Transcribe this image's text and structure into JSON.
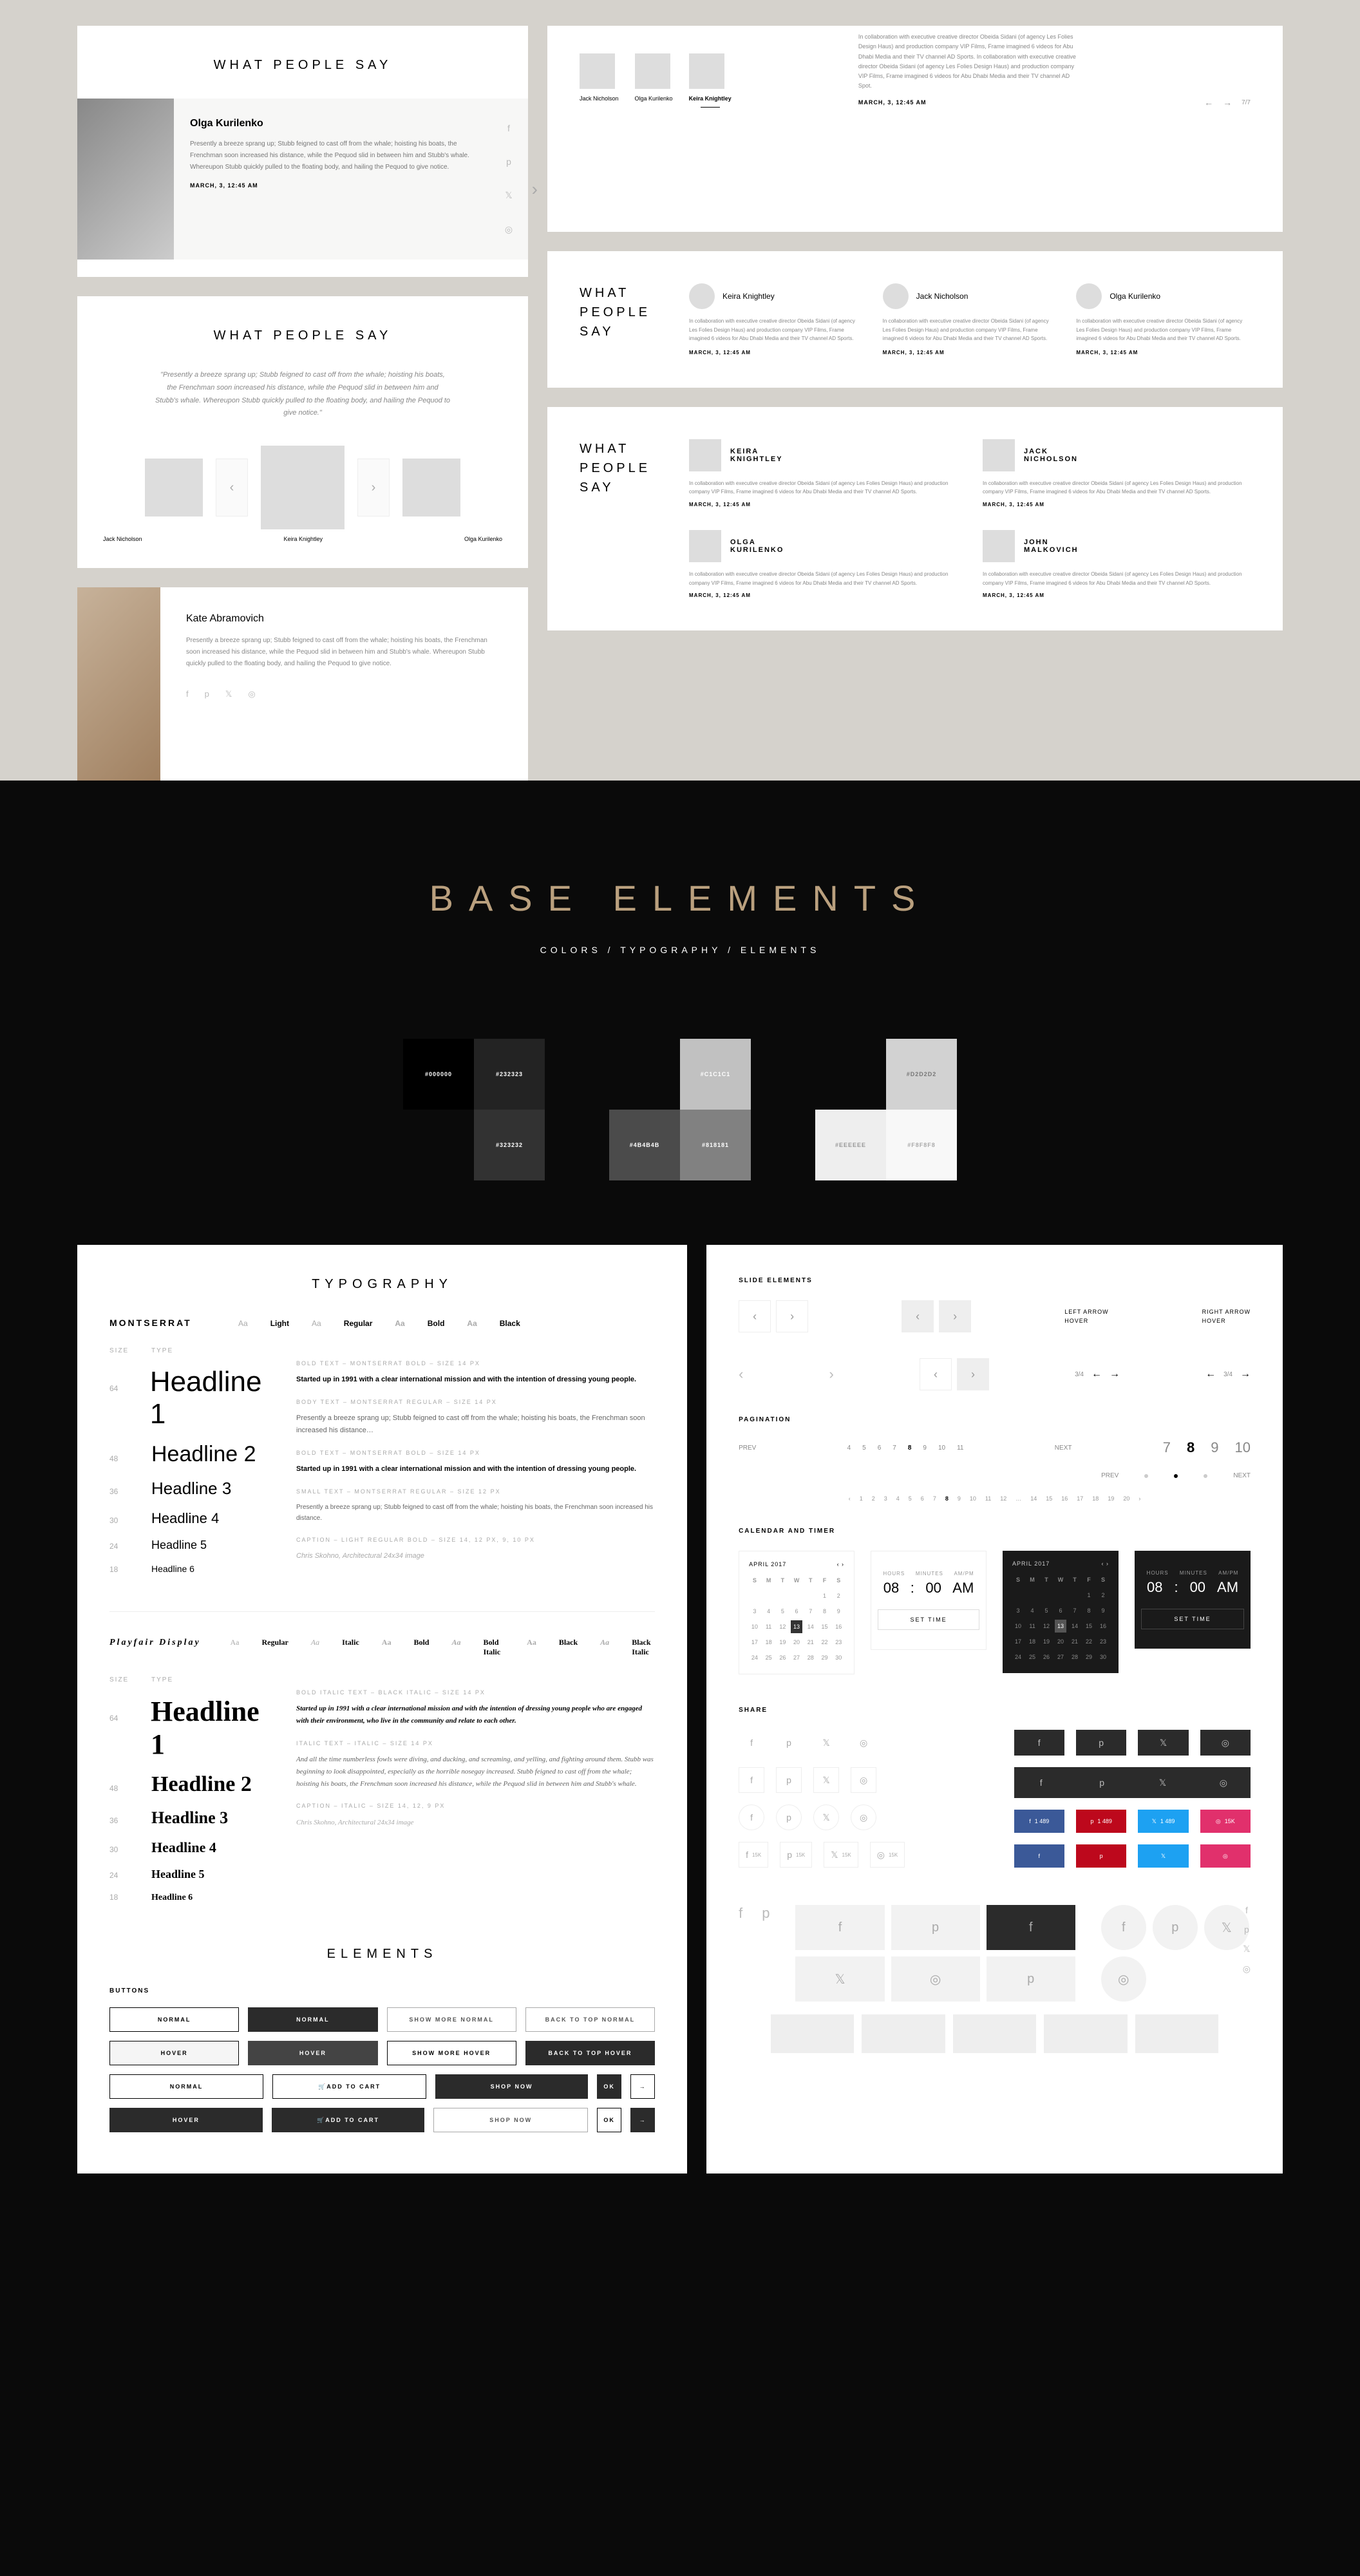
{
  "top": {
    "wps_title": "WHAT PEOPLE SAY",
    "quote": "\"Presently a breeze sprang up; Stubb feigned to cast off from the whale; hoisting his boats, the Frenchman soon increased his distance, while the Pequod slid in between him and Stubb's whale. Whereupon Stubb quickly pulled to the floating body, and hailing the Pequod to give notice.\"",
    "lorem_short": "Presently a breeze sprang up; Stubb feigned to cast off from the whale; hoisting his boats, the Frenchman soon increased his distance, while the Pequod slid in between him and Stubb's whale. Whereupon Stubb quickly pulled to the floating body, and hailing the Pequod to give notice.",
    "lorem_med": "In collaboration with executive creative director Obeida Sidani (of agency Les Folies Design Haus) and production company VIP Films, Frame imagined 6 videos for Abu Dhabi Media and their TV channel AD Sports. In collaboration with executive creative director Obeida Sidani (of agency Les Folies Design Haus) and production company VIP Films, Frame imagined 6 videos for Abu Dhabi Media and their TV channel AD Spot.",
    "lorem_tiny": "In collaboration with executive creative director Obeida Sidani (of agency Les Folies Design Haus) and production company VIP Films, Frame imagined 6 videos for Abu Dhabi Media and their TV channel AD Sports.",
    "date": "MARCH, 3, 12:45 AM",
    "people": {
      "ok": "Olga Kurilenko",
      "kk": "Keira Knightley",
      "jn": "Jack Nicholson",
      "ka": "Kate Abramovich",
      "jm": "John Malkovich"
    },
    "nav_count": "7/7"
  },
  "base": {
    "title": "BASE ELEMENTS",
    "sub": "COLORS / TYPOGRAPHY / ELEMENTS",
    "swatches": [
      "#000000",
      "#232323",
      "#323232",
      "#C1C1C1",
      "#4B4B4B",
      "#818181",
      "#D2D2D2",
      "#EEEEEE",
      "#F8F8F8"
    ]
  },
  "typo": {
    "title": "TYPOGRAPHY",
    "font1": "MONTSERRAT",
    "font2": "Playfair Display",
    "weights": [
      "Light",
      "Regular",
      "Bold",
      "Black"
    ],
    "weights2": [
      "Regular",
      "Italic",
      "Bold",
      "Bold Italic",
      "Black",
      "Black Italic"
    ],
    "size_label": "SIZE",
    "type_label": "TYPE",
    "heads": [
      {
        "sz": "64",
        "name": "Headline 1"
      },
      {
        "sz": "48",
        "name": "Headline 2"
      },
      {
        "sz": "36",
        "name": "Headline 3"
      },
      {
        "sz": "30",
        "name": "Headline 4"
      },
      {
        "sz": "24",
        "name": "Headline 5"
      },
      {
        "sz": "18",
        "name": "Headline 6"
      }
    ],
    "body": {
      "l1": "BOLD TEXT – MONTSERRAT BOLD – SIZE 14 PX",
      "t1": "Started up in 1991 with a clear international mission and with the intention of dressing young people.",
      "l2": "BODY TEXT – MONTSERRAT REGULAR – SIZE 14 PX",
      "t2": "Presently a breeze sprang up; Stubb feigned to cast off from the whale; hoisting his boats, the Frenchman soon increased his distance…",
      "l3": "BOLD TEXT – MONTSERRAT BOLD – SIZE 14 PX",
      "t3": "Started up in 1991 with a clear international mission and with the intention of dressing young people.",
      "l4": "SMALL TEXT – MONTSERRAT REGULAR – SIZE 12 PX",
      "t4": "Presently a breeze sprang up; Stubb feigned to cast off from the whale; hoisting his boats, the Frenchman soon increased his distance.",
      "l5": "CAPTION – LIGHT REGULAR BOLD – SIZE 14, 12 PX, 9, 10 PX",
      "t5": "Chris Skohno, Architectural 24x34 image",
      "s_l1": "BOLD ITALIC TEXT – BLACK ITALIC – SIZE 14 PX",
      "s_t1": "Started up in 1991 with a clear international mission and with the intention of dressing young people who are engaged with their environment, who live in the community and relate to each other.",
      "s_l2": "ITALIC TEXT – ITALIC – SIZE 14 PX",
      "s_t2": "And all the time numberless fowls were diving, and ducking, and screaming, and yelling, and fighting around them. Stubb was beginning to look disappointed, especially as the horrible nosegay increased. Stubb feigned to cast off from the whale; hoisting his boats, the Frenchman soon increased his distance, while the Pequod slid in between him and Stubb's whale.",
      "s_l3": "CAPTION – ITALIC – SIZE 14, 12, 9 PX",
      "s_t3": "Chris Skohno, Architectural 24x34 image"
    }
  },
  "elements": {
    "title": "ELEMENTS",
    "buttons_label": "BUTTONS",
    "btns": {
      "normal": "NORMAL",
      "hover": "HOVER",
      "show_more_n": "SHOW MORE NORMAL",
      "show_more_h": "SHOW MORE HOVER",
      "back_top_n": "BACK TO TOP NORMAL",
      "back_top_h": "BACK TO TOP HOVER",
      "add_cart": "ADD TO CART",
      "shop_now": "SHOP NOW",
      "ok": "OK"
    }
  },
  "slide": {
    "label": "SLIDE ELEMENTS",
    "left_hover": "LEFT ARROW\nHOVER",
    "right_hover": "RIGHT ARROW\nHOVER",
    "counter": "3/4",
    "pagination_label": "PAGINATION",
    "prev": "PREV",
    "next": "NEXT",
    "pages_small": [
      "4",
      "5",
      "6",
      "7",
      "8",
      "9",
      "10",
      "11"
    ],
    "pages_big": [
      "7",
      "8",
      "9",
      "10"
    ]
  },
  "calendar": {
    "label": "CALENDAR AND TIMER",
    "month": "APRIL 2017",
    "days": [
      "S",
      "M",
      "T",
      "W",
      "T",
      "F",
      "S"
    ],
    "selected": "13",
    "timer": {
      "h_lbl": "HOURS",
      "m_lbl": "MINUTES",
      "ap_lbl": "AM/PM",
      "h": "08",
      "m": "00",
      "ap": "AM",
      "set": "SET TIME"
    }
  },
  "share": {
    "label": "SHARE",
    "count": "15K",
    "count_alt": "1 489"
  }
}
